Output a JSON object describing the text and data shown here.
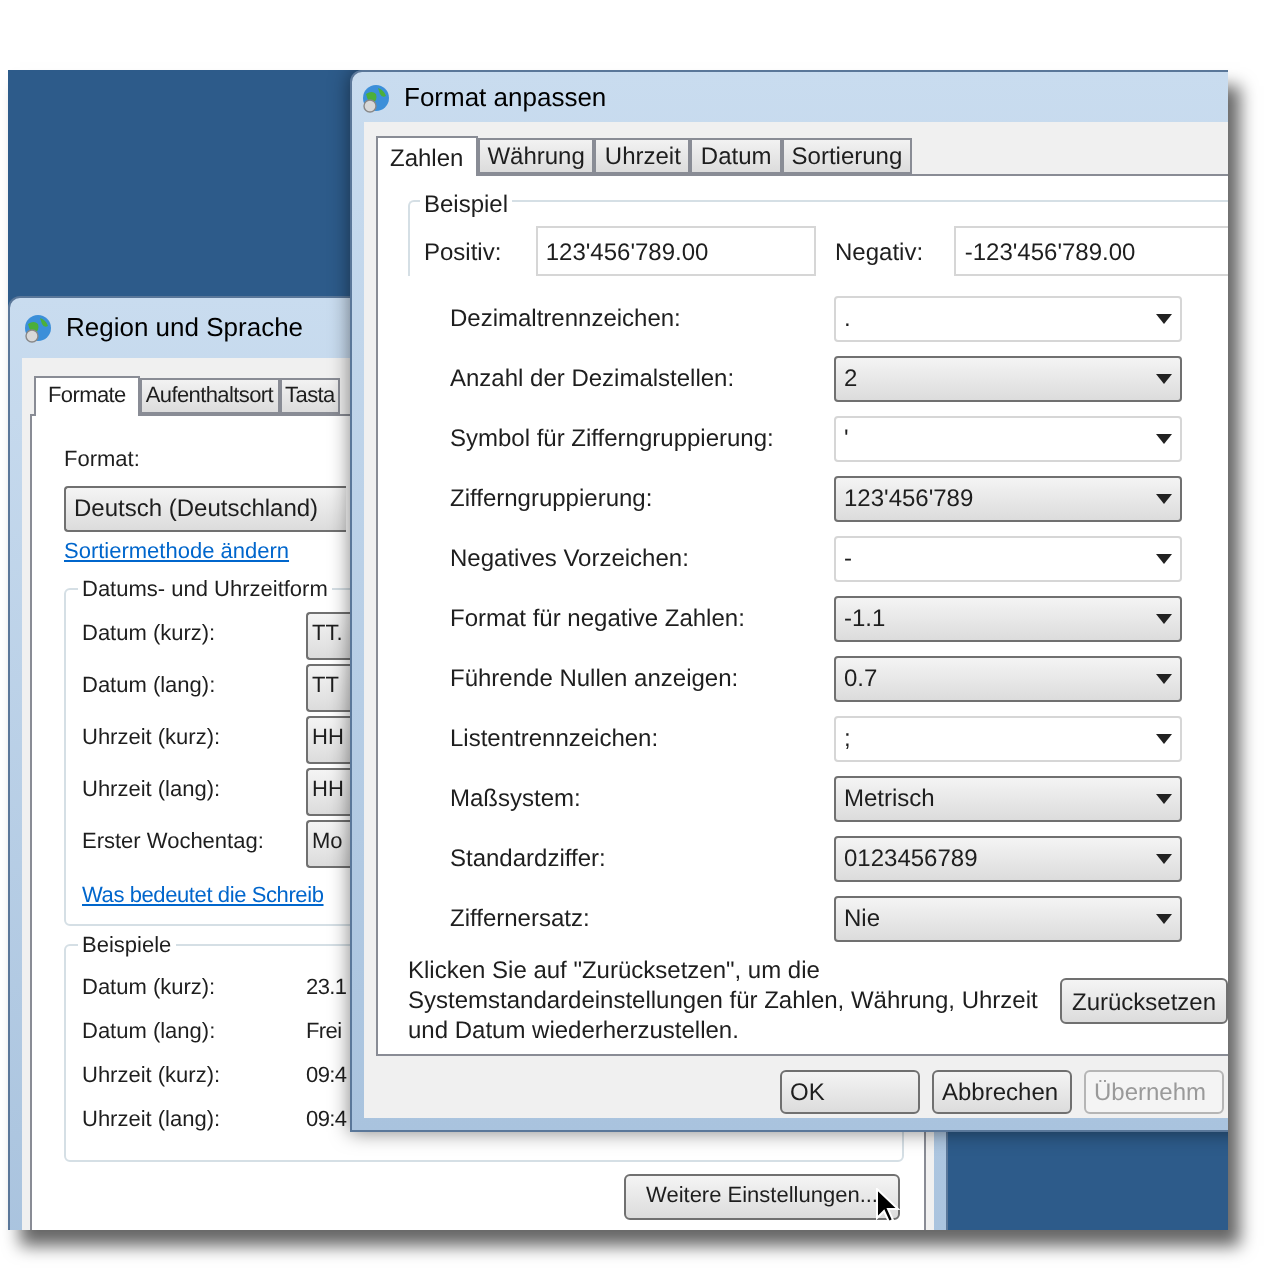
{
  "back_window": {
    "title": "Region und Sprache",
    "tabs": [
      {
        "label": "Formate",
        "selected": true
      },
      {
        "label": "Aufenthaltsort",
        "selected": false
      },
      {
        "label": "Tasta",
        "selected": false
      }
    ],
    "format_label": "Format:",
    "format_value": "Deutsch (Deutschland)",
    "sort_link": "Sortiermethode ändern",
    "datetime_group": {
      "title": "Datums- und Uhrzeitform",
      "rows": [
        {
          "label": "Datum (kurz):",
          "value": "TT."
        },
        {
          "label": "Datum (lang):",
          "value": "TT"
        },
        {
          "label": "Uhrzeit (kurz):",
          "value": "HH"
        },
        {
          "label": "Uhrzeit (lang):",
          "value": "HH"
        },
        {
          "label": "Erster Wochentag:",
          "value": "Mo"
        }
      ]
    },
    "help_link": "Was bedeutet die Schreib",
    "examples_group": {
      "title": "Beispiele",
      "rows": [
        {
          "label": "Datum (kurz):",
          "value": "23.1"
        },
        {
          "label": "Datum (lang):",
          "value": "Frei"
        },
        {
          "label": "Uhrzeit (kurz):",
          "value": "09:4"
        },
        {
          "label": "Uhrzeit (lang):",
          "value": "09:4"
        }
      ]
    },
    "more_button": "Weitere Einstellungen..."
  },
  "front_window": {
    "title": "Format anpassen",
    "tabs": [
      {
        "label": "Zahlen",
        "selected": true
      },
      {
        "label": "Währung",
        "selected": false
      },
      {
        "label": "Uhrzeit",
        "selected": false
      },
      {
        "label": "Datum",
        "selected": false
      },
      {
        "label": "Sortierung",
        "selected": false
      }
    ],
    "example_group": {
      "title": "Beispiel",
      "positive_label": "Positiv:",
      "positive_value": "123'456'789.00",
      "negative_label": "Negativ:",
      "negative_value": "-123'456'789.00"
    },
    "settings": [
      {
        "label": "Dezimaltrennzeichen:",
        "value": ".",
        "kind": "editable"
      },
      {
        "label": "Anzahl der Dezimalstellen:",
        "value": "2",
        "kind": "list"
      },
      {
        "label": "Symbol für Zifferngruppierung:",
        "value": "'",
        "kind": "editable"
      },
      {
        "label": "Zifferngruppierung:",
        "value": "123'456'789",
        "kind": "list"
      },
      {
        "label": "Negatives Vorzeichen:",
        "value": "-",
        "kind": "editable"
      },
      {
        "label": "Format für negative Zahlen:",
        "value": "-1.1",
        "kind": "list"
      },
      {
        "label": "Führende Nullen anzeigen:",
        "value": "0.7",
        "kind": "list"
      },
      {
        "label": "Listentrennzeichen:",
        "value": ";",
        "kind": "editable"
      },
      {
        "label": "Maßsystem:",
        "value": "Metrisch",
        "kind": "list"
      },
      {
        "label": "Standardziffer:",
        "value": "0123456789",
        "kind": "list"
      },
      {
        "label": "Ziffernersatz:",
        "value": "Nie",
        "kind": "list"
      }
    ],
    "reset_text": "Klicken Sie auf \"Zurücksetzen\", um die Systemstandardeinstellungen für Zahlen, Währung, Uhrzeit und Datum wiederherzustellen.",
    "reset_button": "Zurücksetzen",
    "buttons": [
      {
        "label": "OK",
        "disabled": false
      },
      {
        "label": "Abbrechen",
        "disabled": false
      },
      {
        "label": "Übernehm",
        "disabled": true
      }
    ]
  }
}
